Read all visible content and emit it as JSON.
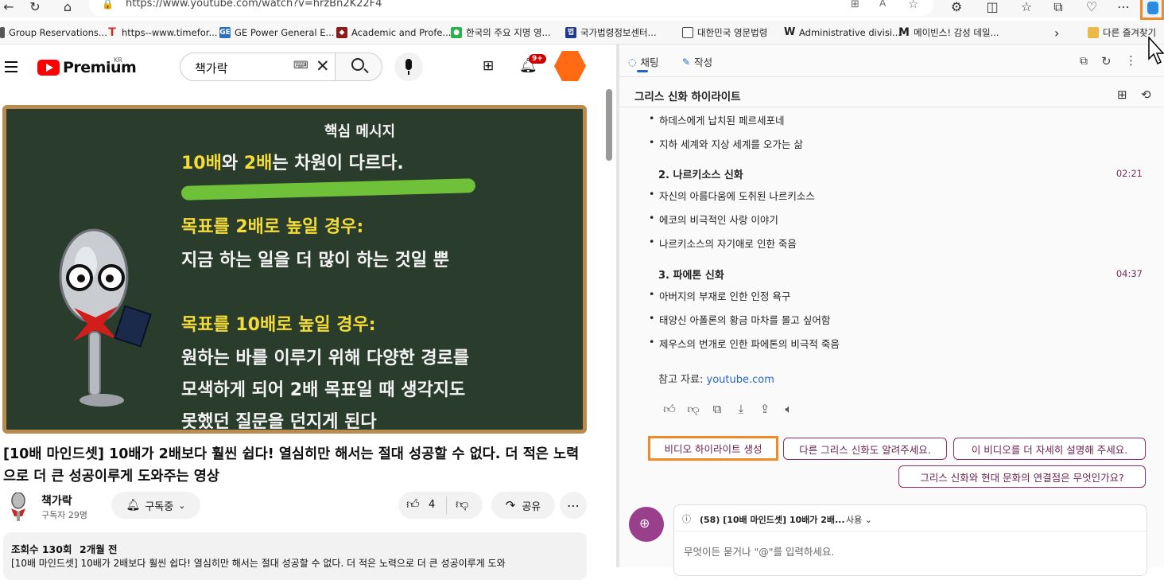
{
  "browser": {
    "url": "https://www.youtube.com/watch?v=hrzBn2K22F4",
    "bookmarks": [
      "Group Reservations...",
      "https--www.timefor...",
      "GE Power  General E...",
      "Academic and Profe...",
      "한국의 주요 지명 영...",
      "국가법령정보센터...",
      "대한민국 영문법령",
      "Administrative divisi...",
      "메이빈스! 감성 데일...",
      "다른 즐겨찾기"
    ]
  },
  "youtube": {
    "logo_text": "Premium",
    "logo_region": "KR",
    "search_value": "책가락",
    "notification_badge": "9+"
  },
  "video": {
    "board": {
      "heading": "핵심 메시지",
      "line1_a": "10배",
      "line1_b": "와 ",
      "line1_c": "2배",
      "line1_d": "는 차원이 다르다.",
      "case1_title": "목표를 2배로 높일 경우:",
      "case1_body": "지금 하는 일을 더 많이 하는 것일 뿐",
      "case2_title": "목표를 10배로 높일 경우:",
      "case2_line1": "원하는 바를 이루기 위해 다양한 경로를",
      "case2_line2": "모색하게 되어 2배 목표일 때 생각지도",
      "case2_line3": "못했던 질문을 던지게 된다"
    },
    "title": "[10배 마인드셋] 10배가 2배보다 훨씬 쉽다! 열심히만 해서는 절대 성공할 수 없다. 더 적은 노력으로 더 큰 성공이루게 도와주는 영상",
    "channel_name": "책가락",
    "subscribers": "구독자 29명",
    "subscribe_label": "구독중",
    "like_count": "4",
    "share_label": "공유",
    "views": "조회수 130회",
    "uploaded": "2개월 전",
    "description": "[10배 마인드셋] 10배가 2배보다 훨씬 쉽다! 열심히만 해서는 절대 성공할 수 없다. 더 적은 노력으로 더 큰 성공이루게 도와"
  },
  "copilot": {
    "tab_chat": "채팅",
    "tab_compose": "작성",
    "panel_title": "그리스 신화 하이라이트",
    "top_bullets": [
      "하데스에게 납치된 페르세포네",
      "지하 세계와 지상 세계를 오가는 삶"
    ],
    "sections": [
      {
        "title": "2. 나르키소스 신화",
        "time": "02:21",
        "bullets": [
          "자신의 아름다움에 도취된 나르키소스",
          "에코의 비극적인 사랑 이야기",
          "나르키소스의 자기애로 인한 죽음"
        ]
      },
      {
        "title": "3. 파에톤 신화",
        "time": "04:37",
        "bullets": [
          "아버지의 부재로 인한 인정 욕구",
          "태양신 아폴론의 황금 마차를 몰고 싶어함",
          "제우스의 번개로 인한 파에톤의 비극적 죽음"
        ]
      }
    ],
    "reference_label": "참고 자료: ",
    "reference_link": "youtube.com",
    "chips": [
      "비디오 하이라이트 생성",
      "다른 그리스 신화도 알려주세요.",
      "이 비디오를 더 자세히 설명해 주세요.",
      "그리스 신화와 현대 문화의 연결점은 무엇인가요?"
    ],
    "context_label": "(58) [10배 마인드셋] 10배가 2배...",
    "context_use": "사용",
    "input_placeholder": "무엇이든 묻거나 \"@\"를 입력하세요."
  }
}
